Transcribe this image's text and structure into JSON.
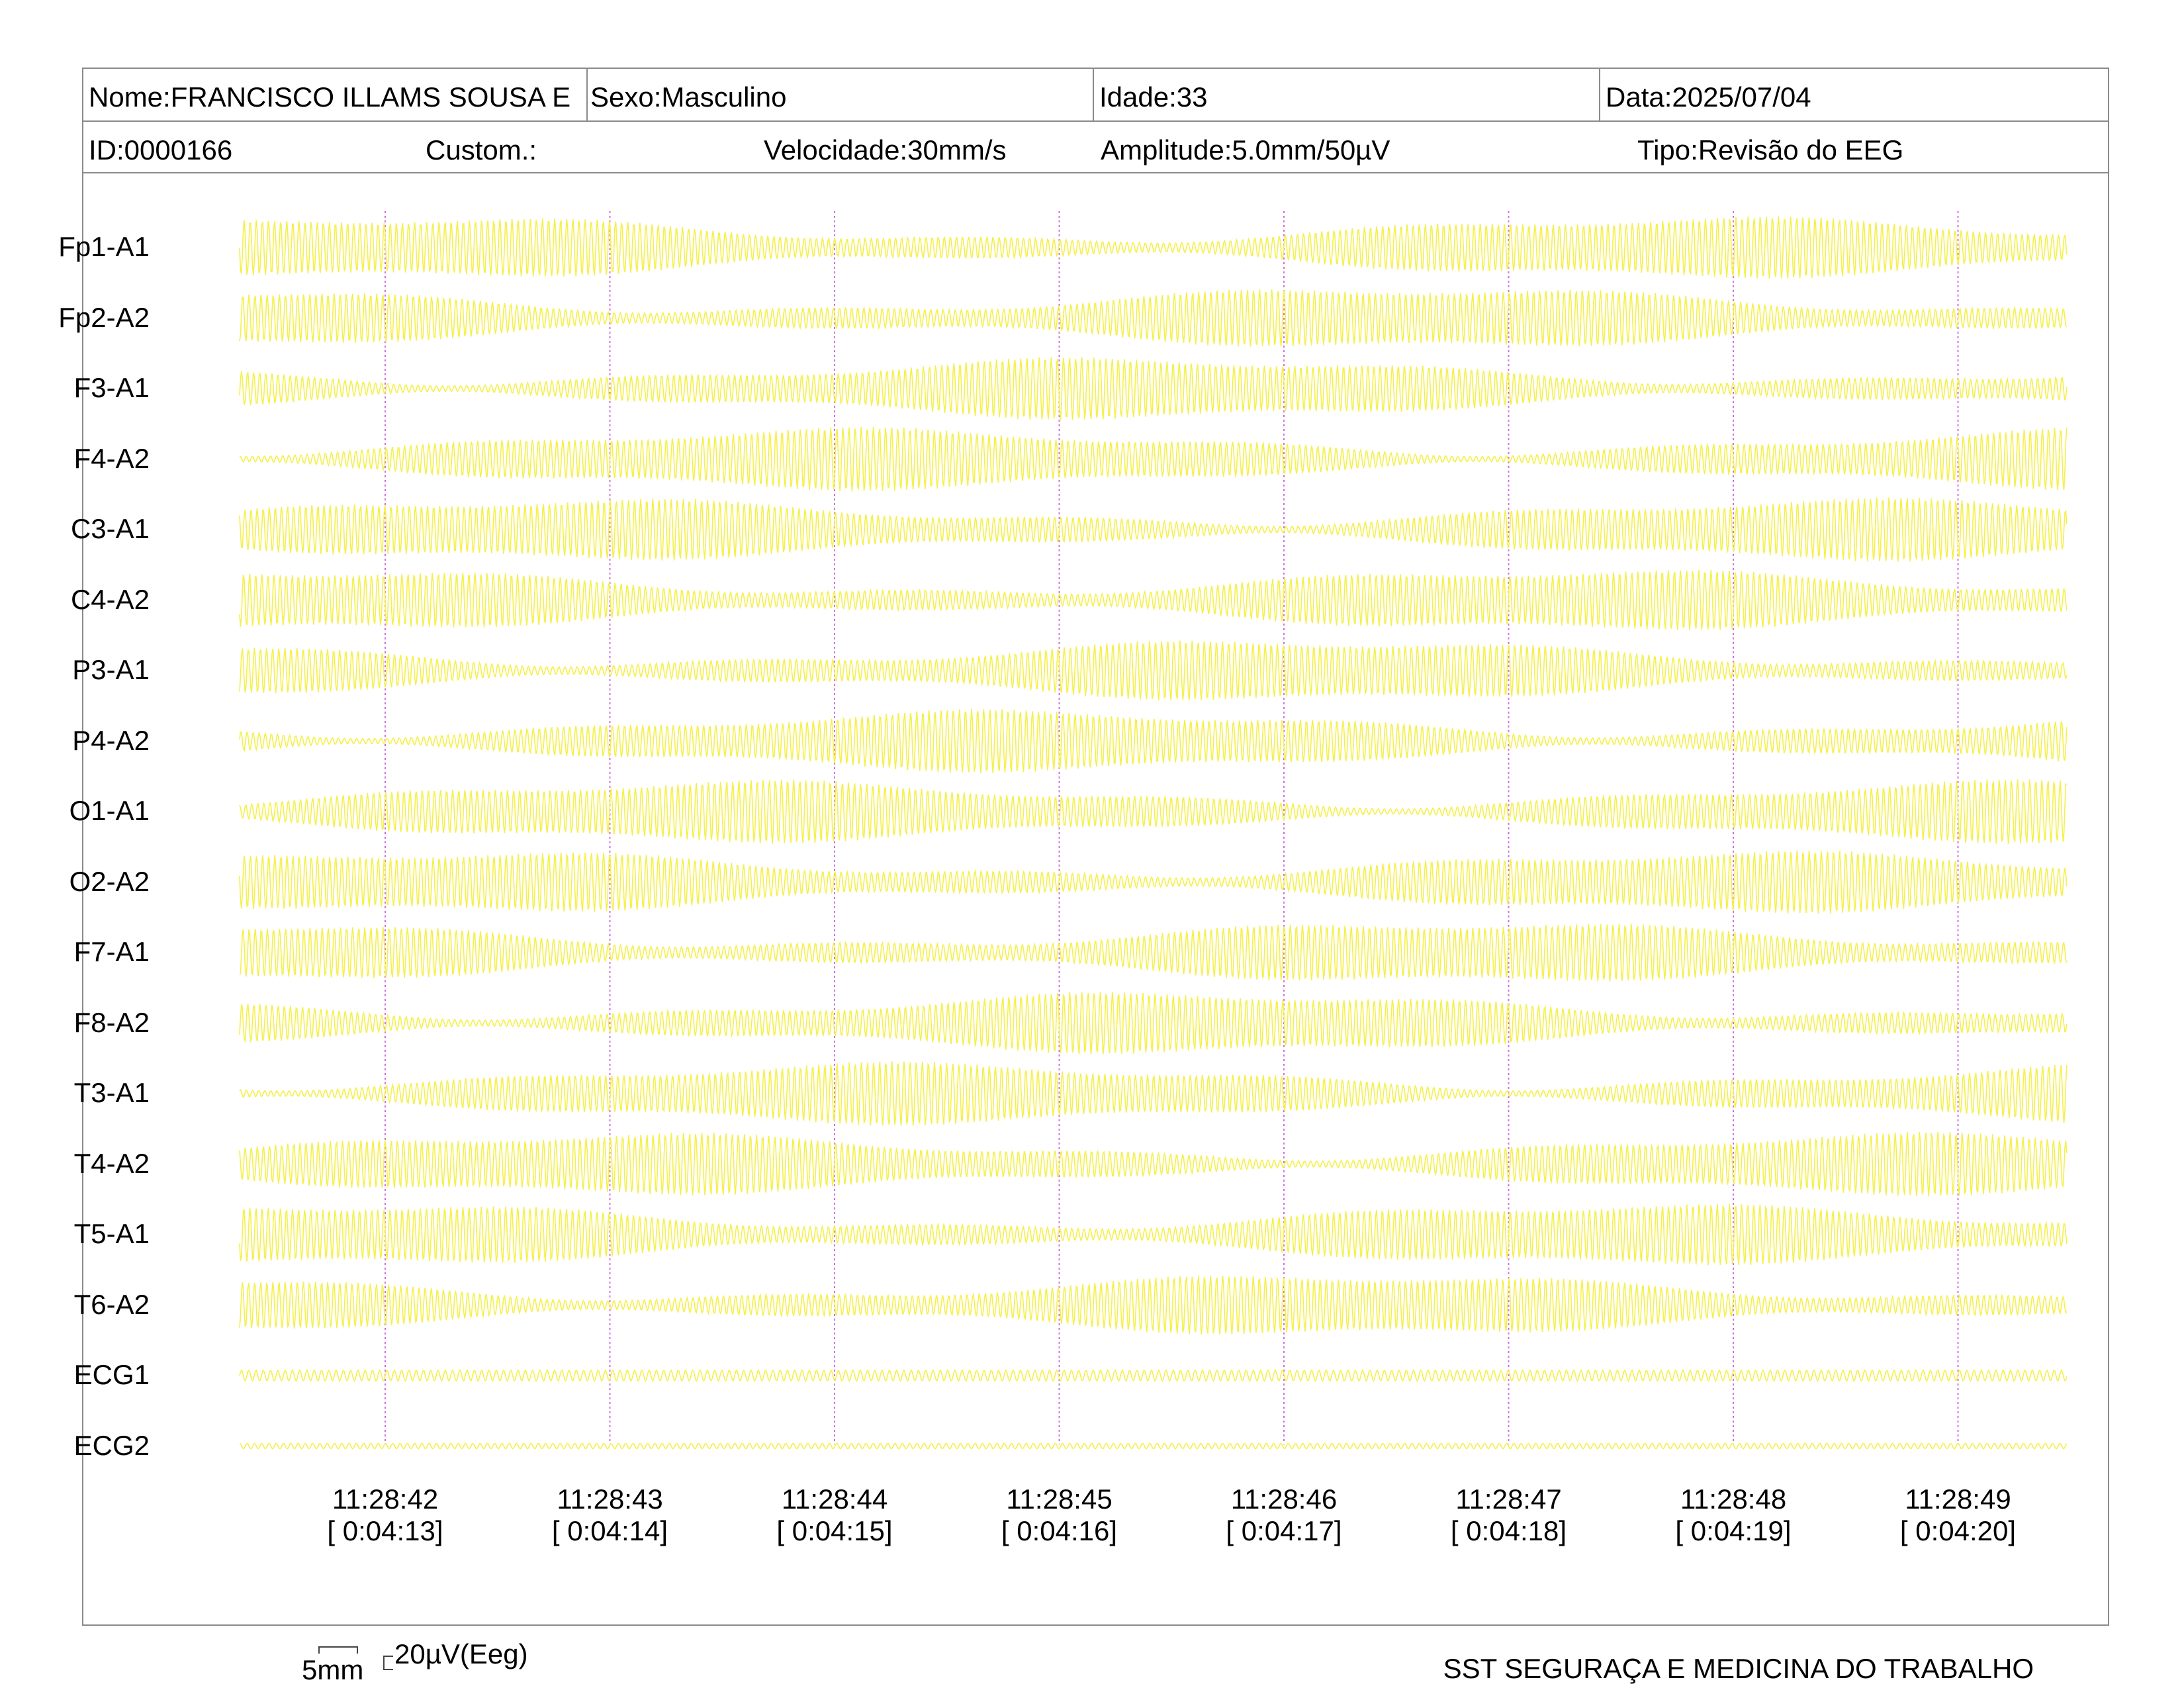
{
  "header": {
    "nome": "Nome:FRANCISCO ILLAMS SOUSA E",
    "sexo": "Sexo:Masculino",
    "idade": "Idade:33",
    "data": "Data:2025/07/04",
    "id": "ID:0000166",
    "custom": "Custom.:",
    "velocidade": "Velocidade:30mm/s",
    "amplitude": "Amplitude:5.0mm/50µV",
    "tipo": "Tipo:Revisão do EEG"
  },
  "channels": [
    "Fp1-A1",
    "Fp2-A2",
    "F3-A1",
    "F4-A2",
    "C3-A1",
    "C4-A2",
    "P3-A1",
    "P4-A2",
    "O1-A1",
    "O2-A2",
    "F7-A1",
    "F8-A2",
    "T3-A1",
    "T4-A2",
    "T5-A1",
    "T6-A2",
    "ECG1",
    "ECG2"
  ],
  "time_marks": [
    {
      "clock": "11:28:42",
      "elapsed": "[ 0:04:13]"
    },
    {
      "clock": "11:28:43",
      "elapsed": "[ 0:04:14]"
    },
    {
      "clock": "11:28:44",
      "elapsed": "[ 0:04:15]"
    },
    {
      "clock": "11:28:45",
      "elapsed": "[ 0:04:16]"
    },
    {
      "clock": "11:28:46",
      "elapsed": "[ 0:04:17]"
    },
    {
      "clock": "11:28:47",
      "elapsed": "[ 0:04:18]"
    },
    {
      "clock": "11:28:48",
      "elapsed": "[ 0:04:19]"
    },
    {
      "clock": "11:28:49",
      "elapsed": "[ 0:04:20]"
    }
  ],
  "scale": {
    "time_label": "5mm",
    "amp_label": "20µV(Eeg)"
  },
  "footer": {
    "clinic": "SST SEGURAÇA E MEDICINA DO TRABALHO"
  },
  "colors": {
    "trace": "#f5f04a",
    "second_marker": "#d070e0",
    "border": "#8a8a8a"
  }
}
